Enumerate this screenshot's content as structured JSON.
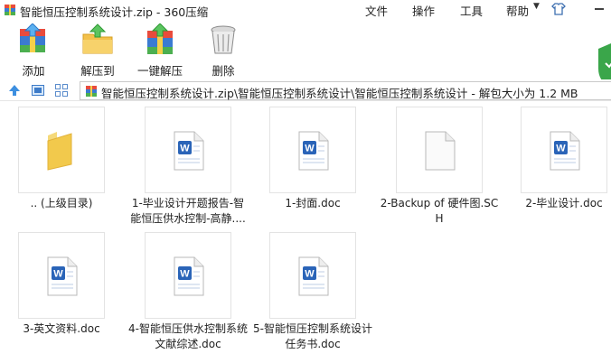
{
  "window": {
    "title": "智能恒压控制系统设计.zip - 360压缩"
  },
  "menu": {
    "file": "文件",
    "operation": "操作",
    "tools": "工具",
    "help": "帮助"
  },
  "toolbar": {
    "add": "添加",
    "extract": "解压到",
    "one_click_extract": "一键解压",
    "delete": "删除"
  },
  "address": {
    "path": "智能恒压控制系统设计.zip\\智能恒压控制系统设计\\智能恒压控制系统设计 - 解包大小为 1.2 MB"
  },
  "files": [
    {
      "name": ".. (上级目录)",
      "type": "folder"
    },
    {
      "name": "1-毕业设计开题报告-智能恒压供水控制-高静....",
      "type": "word"
    },
    {
      "name": "1-封面.doc",
      "type": "word"
    },
    {
      "name": "2-Backup of 硬件图.SCH",
      "type": "blank"
    },
    {
      "name": "2-毕业设计.doc",
      "type": "word"
    },
    {
      "name": "3-英文资料.doc",
      "type": "word"
    },
    {
      "name": "4-智能恒压供水控制系统文献综述.doc",
      "type": "word"
    },
    {
      "name": "5-智能恒压控制系统设计任务书.doc",
      "type": "word"
    }
  ],
  "colors": {
    "word_blue": "#2a64b8",
    "folder_yellow": "#f2c94c",
    "shield_green": "#3aa64a"
  }
}
